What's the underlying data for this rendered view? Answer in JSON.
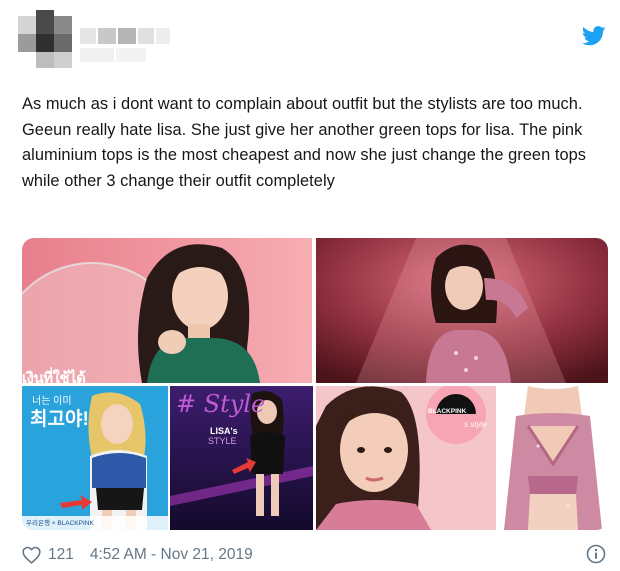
{
  "tweet": {
    "text": "As much as i dont want to complain about outfit but the stylists are too much. Geeun really hate lisa. She just give her another green tops for lisa. The pink aluminium tops is the most cheapest and now she just change the green tops while other 3 change their outfit completely",
    "like_count": "121",
    "timestamp": "4:52 AM - Nov 21, 2019"
  },
  "icons": {
    "brand": "twitter-bird-icon",
    "like": "heart-icon",
    "info": "info-icon"
  },
  "media": {
    "tile1_caption": "เงินที่ใช้ได้",
    "tile3_korean_small": "너는 이미",
    "tile3_korean_big": "최고야!",
    "tile3_bank": "우리은행 × BLACKPINK",
    "tile4_script": "# Style",
    "tile4_lisas": "LISA's",
    "tile4_style": "STYLE",
    "tile5_badge": "BLACKPINK",
    "tile5_badge2": "s style"
  },
  "colors": {
    "twitter_blue": "#1da1f2",
    "text_primary": "#14171a",
    "text_secondary": "#657786"
  }
}
